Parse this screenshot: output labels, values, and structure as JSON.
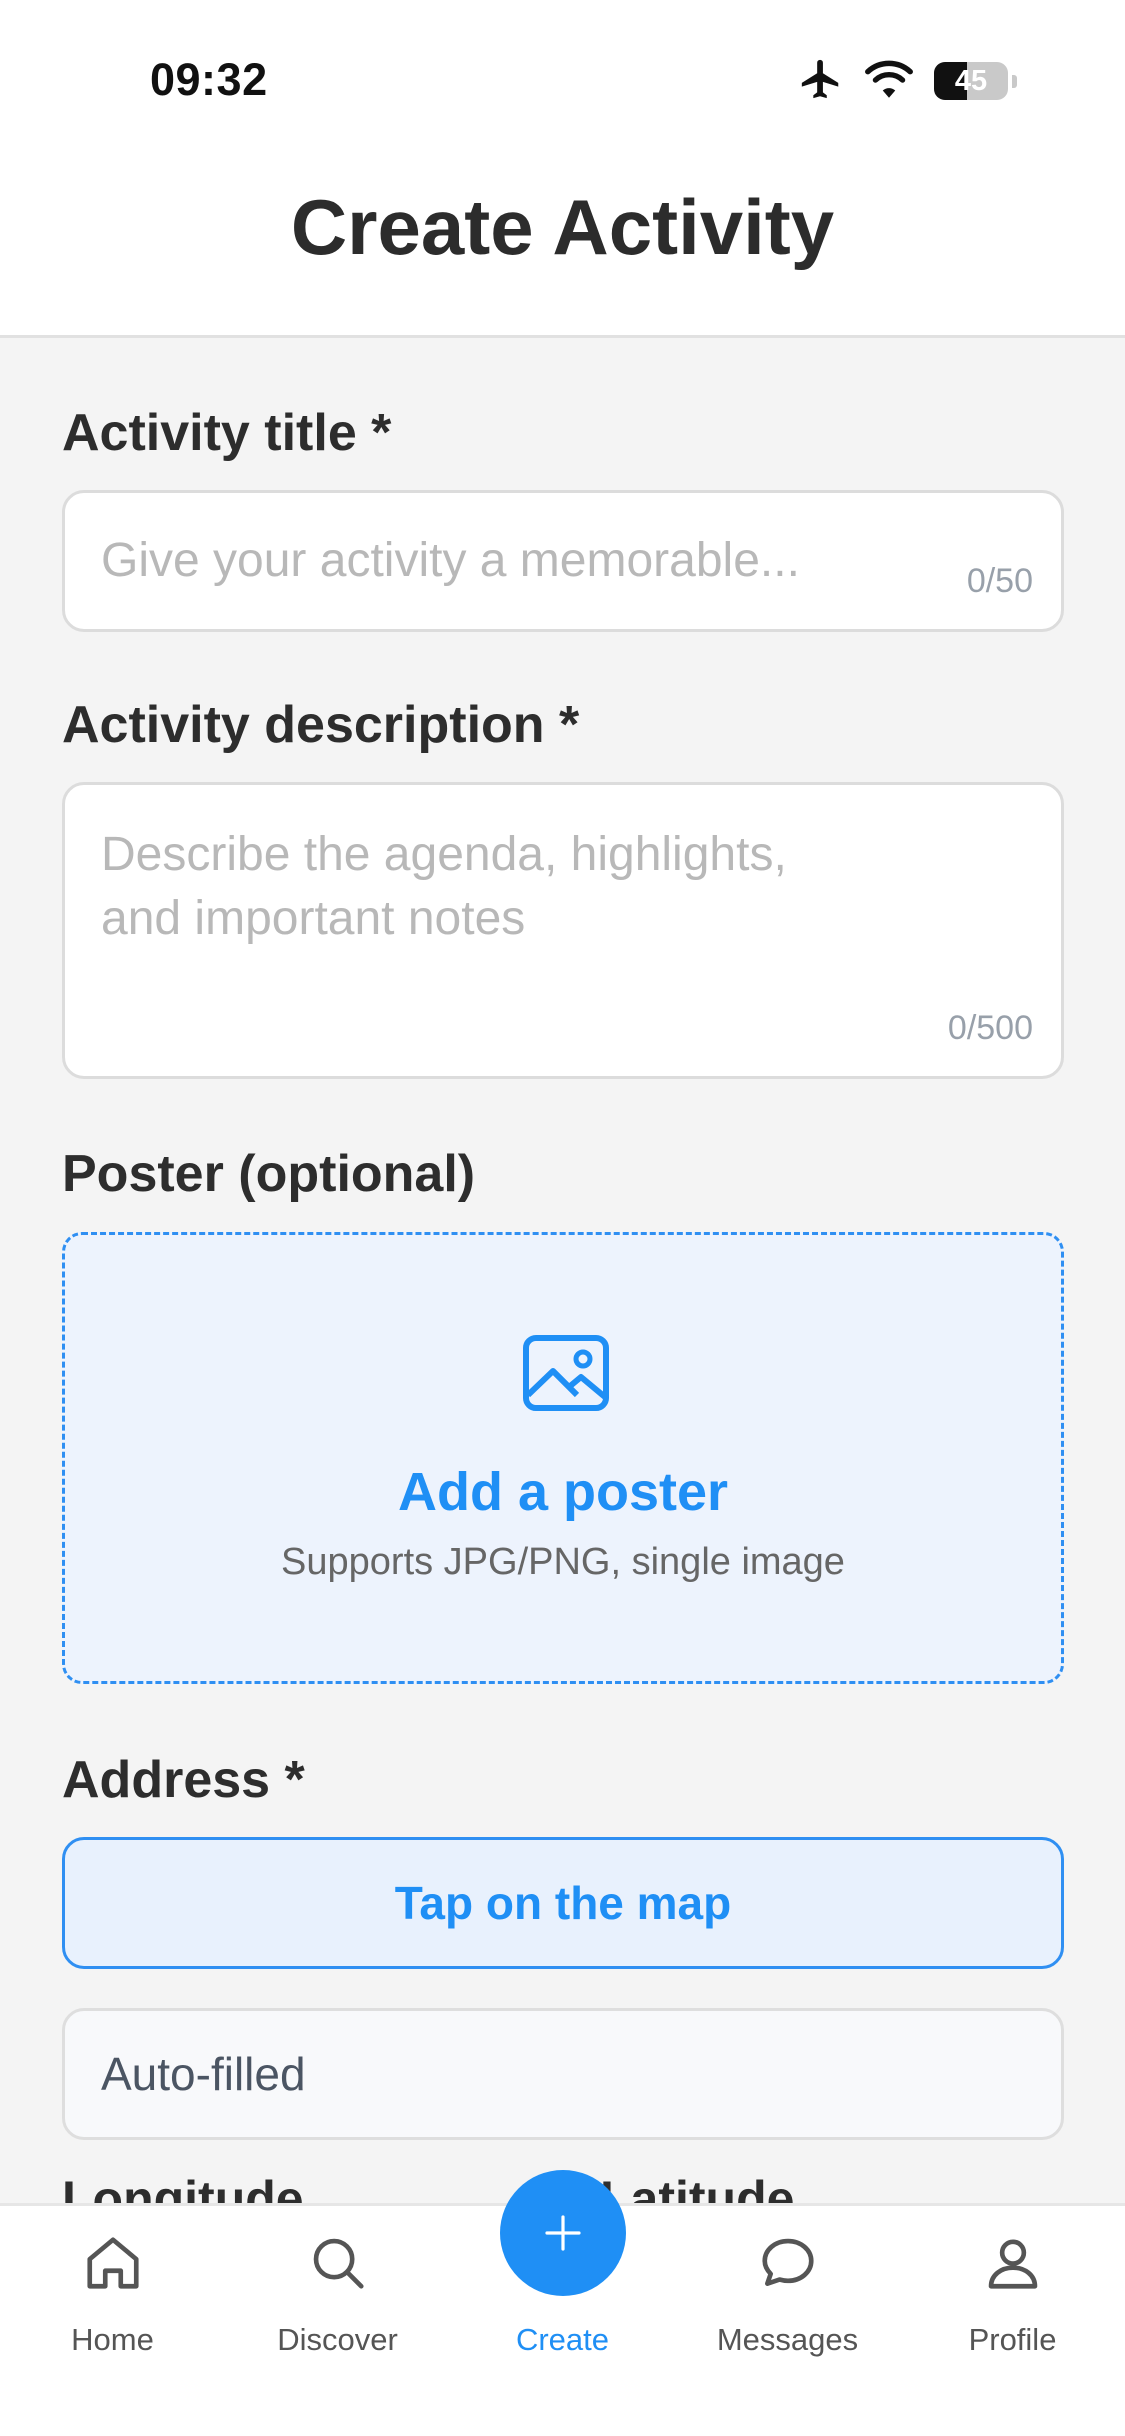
{
  "status_bar": {
    "time": "09:32",
    "battery_level": "45",
    "icons": [
      "airplane-icon",
      "wifi-icon",
      "battery-icon"
    ]
  },
  "header": {
    "title": "Create Activity"
  },
  "form": {
    "title_field": {
      "label": "Activity title *",
      "placeholder": "Give your activity a memorable...",
      "counter": "0/50"
    },
    "description_field": {
      "label": "Activity description *",
      "placeholder_line1": "Describe the agenda, highlights,",
      "placeholder_line2": "and important notes",
      "counter": "0/500"
    },
    "poster": {
      "label": "Poster (optional)",
      "action": "Add a poster",
      "hint": "Supports JPG/PNG, single image",
      "icon": "image-icon"
    },
    "address": {
      "label": "Address  *",
      "map_button": "Tap on the map",
      "auto_value": "Auto-filled"
    },
    "coordinates": {
      "longitude_label": "Longitude",
      "latitude_label": "Latitude"
    }
  },
  "tabbar": {
    "items": [
      {
        "label": "Home",
        "icon": "home-icon"
      },
      {
        "label": "Discover",
        "icon": "search-icon"
      },
      {
        "label": "Create",
        "icon": "plus-icon",
        "active": true
      },
      {
        "label": "Messages",
        "icon": "chat-bubble-icon"
      },
      {
        "label": "Profile",
        "icon": "user-icon"
      }
    ]
  },
  "colors": {
    "accent": "#1f8ff5",
    "background": "#f4f4f4",
    "dropzone_bg": "#edf3fd"
  }
}
